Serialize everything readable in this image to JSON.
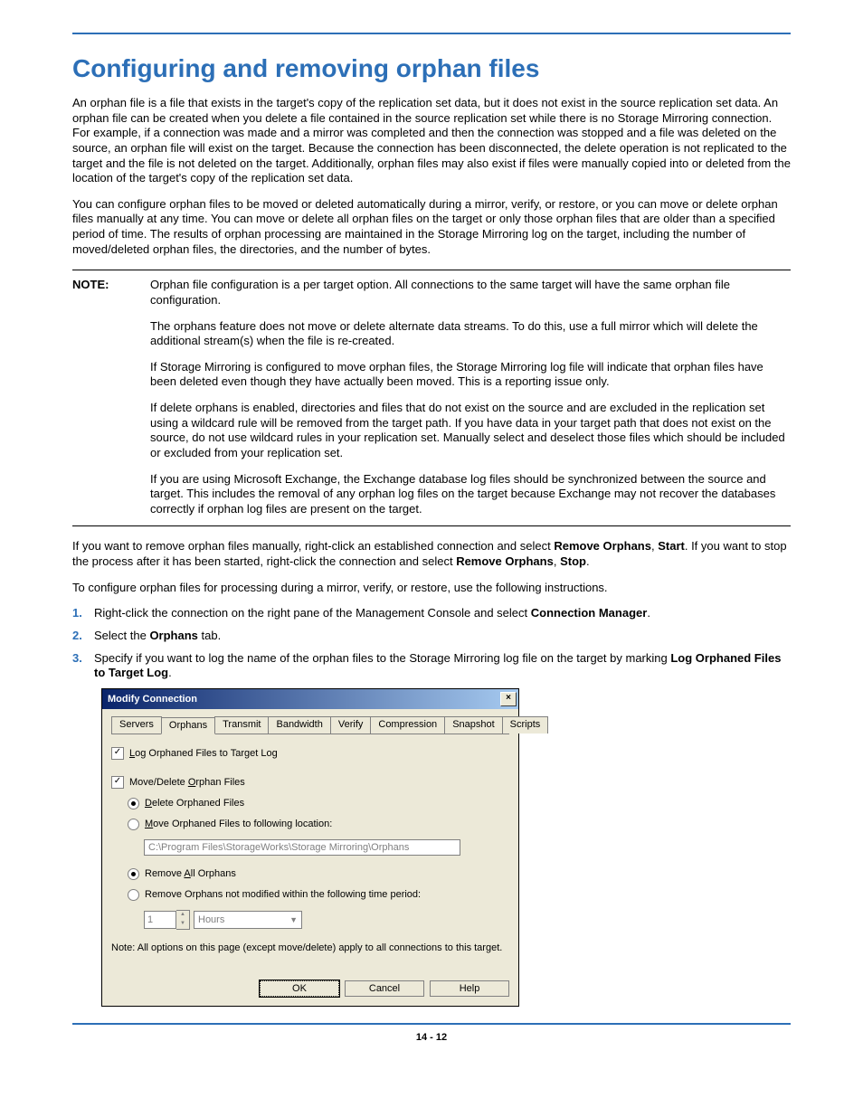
{
  "heading": "Configuring and removing orphan files",
  "para1": "An orphan file is a file that exists in the target's copy of the replication set data, but it does not exist in the source replication set data. An orphan file can be created when you delete a file contained in the source replication set while there is no Storage Mirroring connection. For example, if a connection was made and a mirror was completed and then the connection was stopped and a file was deleted on the source, an orphan file will exist on the target. Because the connection has been disconnected, the delete operation is not replicated to the target and the file is not deleted on the target. Additionally, orphan files may also exist if files were manually copied into or deleted from the location of the target's copy of the replication set data.",
  "para2": "You can configure orphan files to be moved or deleted automatically during a mirror, verify, or restore, or you can move or delete orphan files manually at any time. You can move or delete all orphan files on the target or only those orphan files that are older than a specified period of time. The results of orphan processing are maintained in the Storage Mirroring log on the target, including the number of moved/deleted orphan files, the directories, and the number of bytes.",
  "note_label": "NOTE:",
  "note": {
    "p1": "Orphan file configuration is a per target option. All connections to the same target will have the same orphan file configuration.",
    "p2": "The orphans feature does not move or delete alternate data streams. To do this, use a full mirror which will delete the additional stream(s) when the file is re-created.",
    "p3": "If Storage Mirroring is configured to move orphan files, the Storage Mirroring log file will indicate that orphan files have been deleted even though they have actually been moved. This is a reporting issue only.",
    "p4": "If delete orphans is enabled, directories and files that do not exist on the source and are excluded in the replication set using a wildcard rule will be removed from the target path. If you have data in your target path that does not exist on the source, do not use wildcard rules in your replication set. Manually select and deselect those files which should be included or excluded from your replication set.",
    "p5": "If you are using Microsoft Exchange, the Exchange database log files should be synchronized between the source and target. This includes the removal of any orphan log files on the target because Exchange may not recover the databases correctly if orphan log files are present on the target."
  },
  "para3_pre": "If you want to remove orphan files manually, right-click an established connection and select ",
  "para3_b1": "Remove Orphans",
  "para3_mid1": ", ",
  "para3_b2": "Start",
  "para3_mid2": ". If you want to stop the process after it has been started, right-click the connection and select ",
  "para3_b3": "Remove Orphans",
  "para3_mid3": ", ",
  "para3_b4": "Stop",
  "para3_end": ".",
  "para4": "To configure orphan files for processing during a mirror, verify, or restore, use the following instructions.",
  "steps": {
    "s1": {
      "num": "1.",
      "pre": "Right-click the connection on the right pane of the Management Console and select ",
      "b": "Connection Manager",
      "post": "."
    },
    "s2": {
      "num": "2.",
      "pre": "Select the ",
      "b": "Orphans",
      "post": " tab."
    },
    "s3": {
      "num": "3.",
      "pre": "Specify if you want to log the name of the orphan files to the Storage Mirroring log file on the target by marking ",
      "b": "Log Orphaned Files to Target Log",
      "post": "."
    }
  },
  "dialog": {
    "title": "Modify Connection",
    "tabs": [
      "Servers",
      "Orphans",
      "Transmit",
      "Bandwidth",
      "Verify",
      "Compression",
      "Snapshot",
      "Scripts"
    ],
    "active_tab_index": 1,
    "chk_log": "Log Orphaned Files to Target Log",
    "chk_move": "Move/Delete Orphan Files",
    "rad_delete": "Delete Orphaned Files",
    "rad_move": "Move Orphaned Files to following location:",
    "path": "C:\\Program Files\\StorageWorks\\Storage Mirroring\\Orphans",
    "rad_remove_all": "Remove All Orphans",
    "rad_remove_time": "Remove Orphans not modified within the following time period:",
    "time_value": "1",
    "time_unit": "Hours",
    "notetext": "Note: All options on this page (except move/delete) apply to all connections to this target.",
    "ok": "OK",
    "cancel": "Cancel",
    "help": "Help",
    "close": "×"
  },
  "page_number": "14 - 12"
}
